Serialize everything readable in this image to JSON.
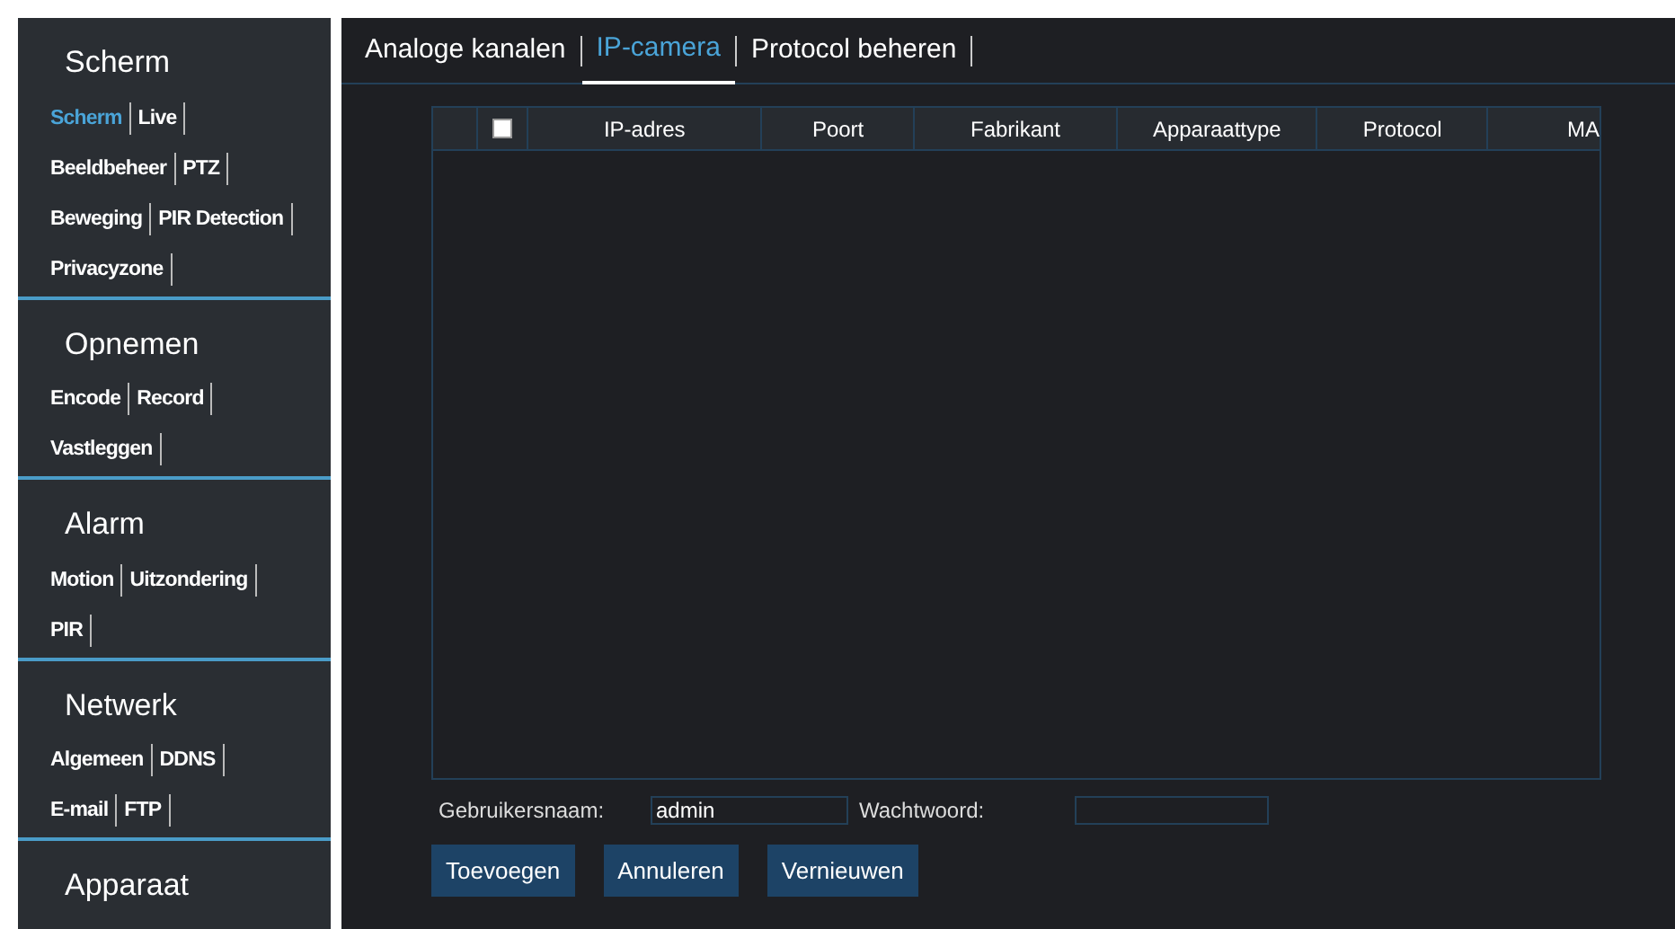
{
  "sidebar": {
    "sections": [
      {
        "title": "Scherm",
        "items": [
          {
            "label": "Scherm",
            "selected": true
          },
          {
            "label": "Live",
            "selected": false
          },
          {
            "label": "Beeldbeheer",
            "selected": false
          },
          {
            "label": "PTZ",
            "selected": false
          },
          {
            "label": "Beweging",
            "selected": false
          },
          {
            "label": "PIR Detection",
            "selected": false
          },
          {
            "label": "Privacyzone",
            "selected": false
          }
        ]
      },
      {
        "title": "Opnemen",
        "items": [
          {
            "label": "Encode",
            "selected": false
          },
          {
            "label": "Record",
            "selected": false
          },
          {
            "label": "Vastleggen",
            "selected": false
          }
        ]
      },
      {
        "title": "Alarm",
        "items": [
          {
            "label": "Motion",
            "selected": false
          },
          {
            "label": "Uitzondering",
            "selected": false
          },
          {
            "label": "PIR",
            "selected": false
          }
        ]
      },
      {
        "title": "Netwerk",
        "items": [
          {
            "label": "Algemeen",
            "selected": false
          },
          {
            "label": "DDNS",
            "selected": false
          },
          {
            "label": "E-mail",
            "selected": false
          },
          {
            "label": "FTP",
            "selected": false
          }
        ]
      },
      {
        "title": "Apparaat"
      }
    ]
  },
  "tabs": [
    {
      "label": "Analoge kanalen",
      "selected": false
    },
    {
      "label": "IP-camera",
      "selected": true
    },
    {
      "label": "Protocol beheren",
      "selected": false
    }
  ],
  "table": {
    "select_all": {
      "checked": false
    },
    "columns": [
      "IP-adres",
      "Poort",
      "Fabrikant",
      "Apparaattype",
      "Protocol",
      "MA"
    ]
  },
  "form": {
    "username": {
      "label": "Gebruikersnaam:",
      "value": "admin"
    },
    "password": {
      "label": "Wachtwoord:"
    }
  },
  "buttons": [
    "Toevoegen",
    "Annuleren",
    "Vernieuwen"
  ]
}
